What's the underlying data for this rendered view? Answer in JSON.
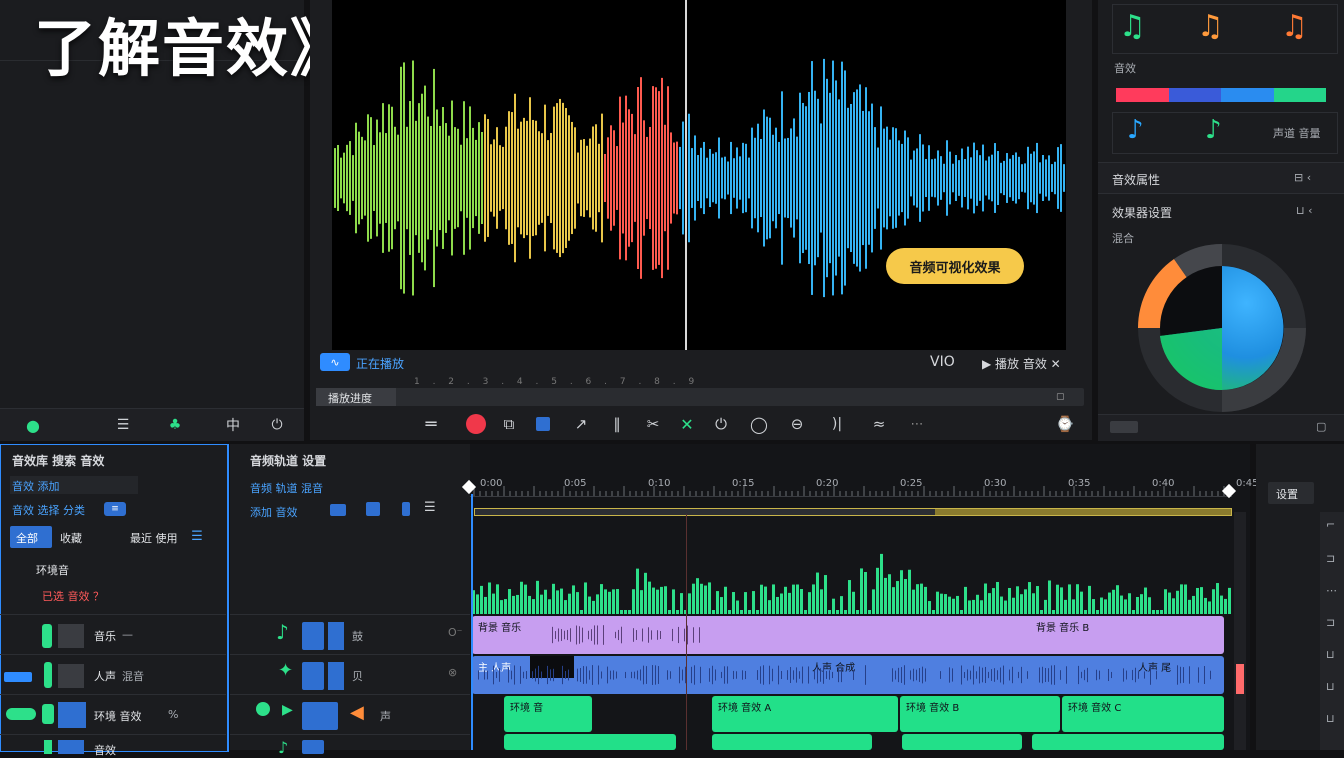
{
  "headline": "了解音效》",
  "colors": {
    "background": "#111113",
    "waveform_green": "#8edb4b",
    "waveform_yellow": "#e8c64a",
    "waveform_red": "#ff5a4f",
    "waveform_blue": "#35b3f2",
    "accent_yellow": "#f6c94a",
    "timeline_green": "#2de08a",
    "clip_purple": "#c79ef0",
    "clip_blue": "#4f7fe0",
    "clip_green": "#22e089",
    "playhead_blue": "#2f8cff"
  },
  "preview": {
    "badge": "正在播放",
    "tooltip": "音频可视化效果",
    "logo_text": "VIO",
    "right_controls": "▶ 播放 音效 ✕",
    "progress_label": "播放进度",
    "ruler_text": "1 . 2 . 3 . 4 . 5 . 6 . 7 . 8 . 9"
  },
  "transport": {
    "icons": [
      "menu-icon",
      "record-icon",
      "clip-icon",
      "stop-icon",
      "cursor-icon",
      "blade-icon",
      "cut-icon",
      "x-icon",
      "loop-icon",
      "comment-icon",
      "chat-icon",
      "volume-icon",
      "wave-icon",
      "more-icon",
      "clock-icon"
    ]
  },
  "right_panel": {
    "section1_label": "音效",
    "section2_title": "音效属性",
    "section3_title": "效果器设置",
    "section3_sub": "混合",
    "mini_label": "声道 音量"
  },
  "left_top": {
    "buttons": [
      "mic-icon",
      "edit-icon",
      "level-icon",
      "shield-icon",
      "mix-icon",
      "power-icon"
    ]
  },
  "library": {
    "title": "音效库 搜索 音效",
    "row1": "音效 添加",
    "row2": "音效 选择 分类",
    "tab_active": "全部",
    "tab2": "收藏",
    "tab3": "最近 使用",
    "section": "环境音",
    "tag": "已选 音效 ？"
  },
  "tracks_header": {
    "title": "音频轨道 设置",
    "row1": "音频 轨道 混音",
    "row2": "添加 音效"
  },
  "timeline": {
    "ticks": [
      "0:00",
      "0:05",
      "0:10",
      "0:15",
      "0:20",
      "0:25",
      "0:30",
      "0:35",
      "0:40",
      "0:45"
    ],
    "right_label": "设置"
  },
  "track_rows": [
    {
      "name": "音乐",
      "detail": "—",
      "label": "鼓"
    },
    {
      "name": "人声",
      "detail": "混音",
      "label": "贝"
    },
    {
      "name": "环境 音效",
      "detail": "%",
      "label": "声"
    },
    {
      "name": "音效",
      "detail": "",
      "label": ""
    }
  ],
  "clips": {
    "purple": [
      "背景 音乐",
      "背景 音乐 B"
    ],
    "blue": [
      "主 人声",
      "人声 合成",
      "人声 尾"
    ],
    "green": [
      "环境 音",
      "环境 音效 A",
      "环境 音效 B",
      "环境 音效 C"
    ]
  }
}
